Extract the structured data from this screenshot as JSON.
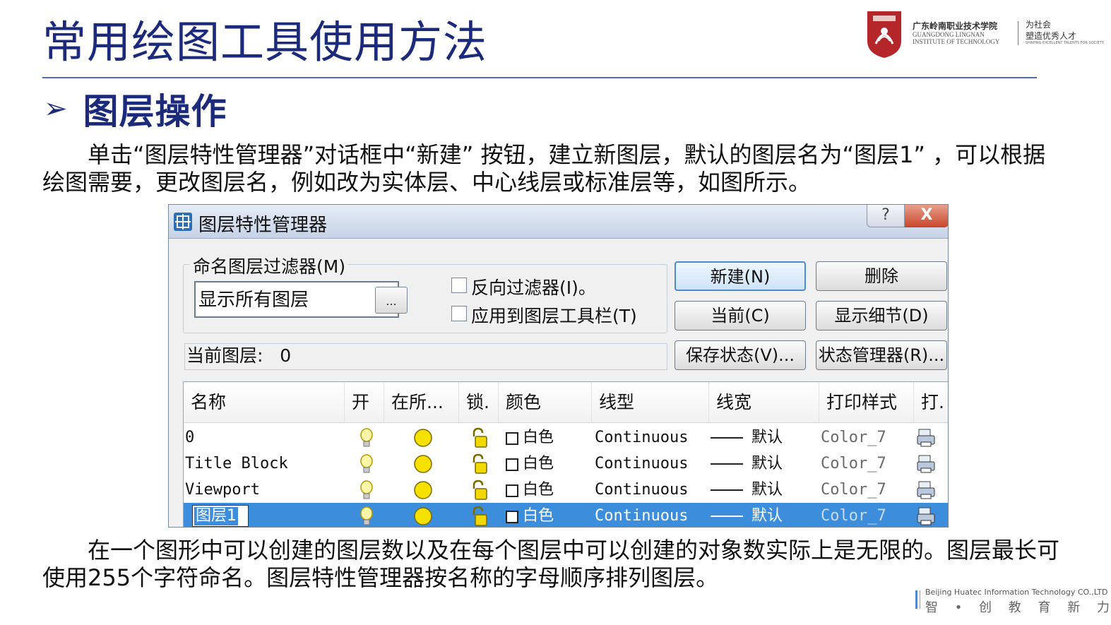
{
  "slide": {
    "title": "常用绘图工具使用方法",
    "section_marker": "➢",
    "section": "图层操作",
    "para1": "　　单击“图层特性管理器”对话框中“新建” 按钮，建立新图层，默认的图层名为“图层1” ，可以根据绘图需要，更改图层名，例如改为实体层、中心线层或标准层等，如图所示。",
    "para2": "　　在一个图形中可以创建的图层数以及在每个图层中可以创建的对象数实际上是无限的。图层最长可使用255个字符命名。图层特性管理器按名称的字母顺序排列图层。"
  },
  "logo": {
    "cn_name": "广东岭南职业技术学院",
    "en_line1": "GUANGDONG LINGNAN",
    "en_line2": "INSTITUTE OF TECHNOLOGY",
    "motto1": "为社会",
    "motto2": "塑造优秀人才",
    "motto3": "SHAPING EXCELLENT TALENTS FOR SOCIETY"
  },
  "footer": {
    "en": "Beijing Huatec Information Technology CO.,LTD",
    "cn": "智 • 创 教 育 新 力 量"
  },
  "dialog": {
    "title": "图层特性管理器",
    "help": "?",
    "close": "X",
    "filter_label": "命名图层过滤器(M)",
    "filter_value": "显示所有图层",
    "filter_more": "...",
    "invert_filter": "反向过滤器(I)。",
    "apply_toolbar": "应用到图层工具栏(T)",
    "current_layer_label": "当前图层:",
    "current_layer_value": "0",
    "buttons": {
      "new": "新建(N)",
      "delete": "删除",
      "current": "当前(C)",
      "details": "显示细节(D)",
      "save_state": "保存状态(V)...",
      "state_manager": "状态管理器(R)..."
    },
    "columns": [
      "名称",
      "开",
      "在所...",
      "锁.",
      "颜色",
      "线型",
      "线宽",
      "打印样式",
      "打."
    ],
    "rows": [
      {
        "name": "0",
        "color": "白色",
        "linetype": "Continuous",
        "lineweight": "默认",
        "plotstyle": "Color_7"
      },
      {
        "name": "Title Block",
        "color": "白色",
        "linetype": "Continuous",
        "lineweight": "默认",
        "plotstyle": "Color_7"
      },
      {
        "name": "Viewport",
        "color": "白色",
        "linetype": "Continuous",
        "lineweight": "默认",
        "plotstyle": "Color_7"
      },
      {
        "name": "图层1",
        "color": "白色",
        "linetype": "Continuous",
        "lineweight": "默认",
        "plotstyle": "Color_7"
      }
    ],
    "selected_row": 3
  },
  "colors": {
    "title": "#1b2a7a",
    "selection": "#3c8edc",
    "brand": "#b5262b"
  },
  "icons": {
    "on": "lightbulb-icon",
    "freeze": "sun-icon",
    "lock": "padlock-icon",
    "plot": "printer-icon"
  }
}
